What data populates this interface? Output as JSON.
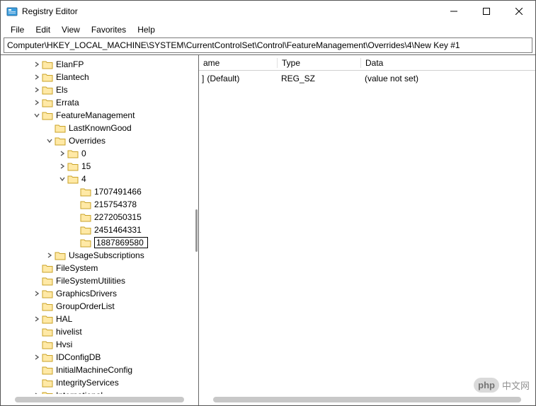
{
  "window": {
    "title": "Registry Editor"
  },
  "menu": {
    "file": "File",
    "edit": "Edit",
    "view": "View",
    "favorites": "Favorites",
    "help": "Help"
  },
  "address": "Computer\\HKEY_LOCAL_MACHINE\\SYSTEM\\CurrentControlSet\\Control\\FeatureManagement\\Overrides\\4\\New Key #1",
  "columns": {
    "name": "ame",
    "type": "Type",
    "data": "Data"
  },
  "value_row": {
    "name": "(Default)",
    "name_prefix": "] ",
    "type": "REG_SZ",
    "data": "(value not set)"
  },
  "tree": {
    "l1": [
      {
        "label": "ElanFP",
        "exp": "closed"
      },
      {
        "label": "Elantech",
        "exp": "closed"
      },
      {
        "label": "Els",
        "exp": "closed"
      },
      {
        "label": "Errata",
        "exp": "closed"
      }
    ],
    "feature": {
      "label": "FeatureManagement",
      "exp": "open"
    },
    "lkg": {
      "label": "LastKnownGood"
    },
    "overrides": {
      "label": "Overrides",
      "exp": "open"
    },
    "ov_children": [
      {
        "label": "0",
        "exp": "closed"
      },
      {
        "label": "15",
        "exp": "closed"
      }
    ],
    "four": {
      "label": "4",
      "exp": "open"
    },
    "four_children": [
      {
        "label": "1707491466"
      },
      {
        "label": "215754378"
      },
      {
        "label": "2272050315"
      },
      {
        "label": "2451464331"
      }
    ],
    "editing": {
      "value": "1887869580"
    },
    "usage": {
      "label": "UsageSubscriptions",
      "exp": "closed"
    },
    "rest": [
      {
        "label": "FileSystem"
      },
      {
        "label": "FileSystemUtilities"
      },
      {
        "label": "GraphicsDrivers",
        "exp": "closed"
      },
      {
        "label": "GroupOrderList"
      },
      {
        "label": "HAL",
        "exp": "closed"
      },
      {
        "label": "hivelist"
      },
      {
        "label": "Hvsi"
      },
      {
        "label": "IDConfigDB",
        "exp": "closed"
      },
      {
        "label": "InitialMachineConfig"
      },
      {
        "label": "IntegrityServices"
      },
      {
        "label": "International",
        "exp": "closed"
      }
    ]
  },
  "watermark": {
    "a": "php",
    "b": "中文网"
  }
}
